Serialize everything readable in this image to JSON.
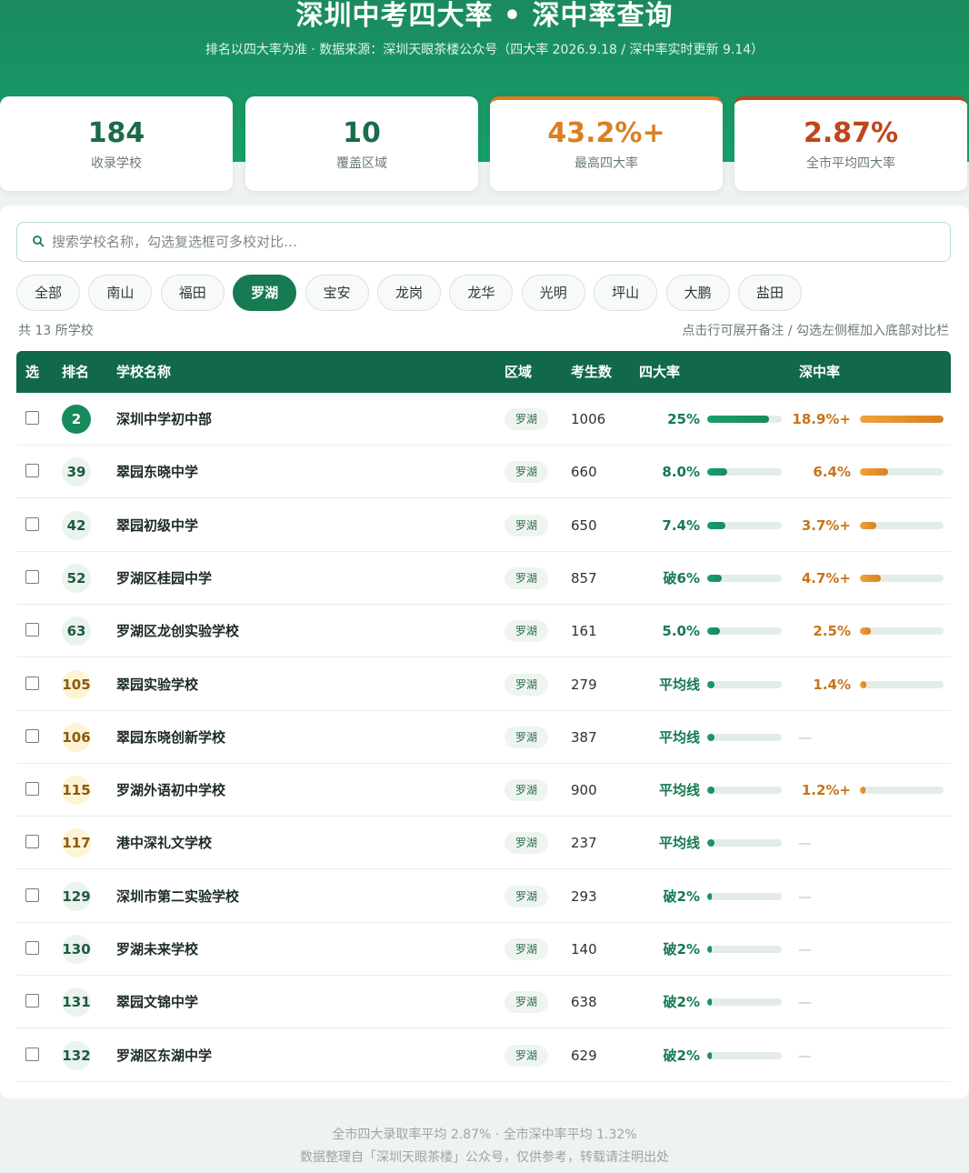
{
  "header": {
    "title": "深圳中考四大率 • 深中率查询",
    "subtitle": "排名以四大率为准 · 数据来源：深圳天眼茶楼公众号（四大率 2026.9.18 / 深中率实时更新 9.14）"
  },
  "stats": [
    {
      "value": "184",
      "label": "收录学校",
      "color": "#1a6b4a"
    },
    {
      "value": "10",
      "label": "覆盖区域",
      "color": "#1a6b4a"
    },
    {
      "value": "43.2%+",
      "label": "最高四大率",
      "color": "#d9801f"
    },
    {
      "value": "2.87%",
      "label": "全市平均四大率",
      "color": "#c0451a"
    }
  ],
  "search": {
    "placeholder": "搜索学校名称，勾选复选框可多校对比…",
    "value": ""
  },
  "filters": [
    "全部",
    "南山",
    "福田",
    "罗湖",
    "宝安",
    "龙岗",
    "龙华",
    "光明",
    "坪山",
    "大鹏",
    "盐田"
  ],
  "active_filter": "罗湖",
  "list_info": {
    "count": "共 13 所学校",
    "hint": "点击行可展开备注 / 勾选左侧框加入底部对比栏"
  },
  "table": {
    "headers": [
      "选",
      "排名",
      "学校名称",
      "区域",
      "考生数",
      "四大率",
      "深中率"
    ],
    "rows": [
      {
        "rank": "2",
        "name": "深圳中学初中部",
        "region": "罗湖",
        "students": "1006",
        "rate4": "25%",
        "rate4_value": 25,
        "sz": "18.9%+",
        "sz_value": 18.9
      },
      {
        "rank": "39",
        "name": "翠园东晓中学",
        "region": "罗湖",
        "students": "660",
        "rate4": "8.0%",
        "rate4_value": 8.0,
        "sz": "6.4%",
        "sz_value": 6.4
      },
      {
        "rank": "42",
        "name": "翠园初级中学",
        "region": "罗湖",
        "students": "650",
        "rate4": "7.4%",
        "rate4_value": 7.4,
        "sz": "3.7%+",
        "sz_value": 3.7
      },
      {
        "rank": "52",
        "name": "罗湖区桂园中学",
        "region": "罗湖",
        "students": "857",
        "rate4": "破6%",
        "rate4_value": 6.0,
        "sz": "4.7%+",
        "sz_value": 4.7
      },
      {
        "rank": "63",
        "name": "罗湖区龙创实验学校",
        "region": "罗湖",
        "students": "161",
        "rate4": "5.0%",
        "rate4_value": 5.0,
        "sz": "2.5%",
        "sz_value": 2.5
      },
      {
        "rank": "105",
        "name": "翠园实验学校",
        "region": "罗湖",
        "students": "279",
        "rate4": "平均线",
        "rate4_value": 2.87,
        "sz": "1.4%",
        "sz_value": 1.4
      },
      {
        "rank": "106",
        "name": "翠园东晓创新学校",
        "region": "罗湖",
        "students": "387",
        "rate4": "平均线",
        "rate4_value": 2.87,
        "sz": "—",
        "sz_value": null
      },
      {
        "rank": "115",
        "name": "罗湖外语初中学校",
        "region": "罗湖",
        "students": "900",
        "rate4": "平均线",
        "rate4_value": 2.87,
        "sz": "1.2%+",
        "sz_value": 1.2
      },
      {
        "rank": "117",
        "name": "港中深礼文学校",
        "region": "罗湖",
        "students": "237",
        "rate4": "平均线",
        "rate4_value": 2.87,
        "sz": "—",
        "sz_value": null
      },
      {
        "rank": "129",
        "name": "深圳市第二实验学校",
        "region": "罗湖",
        "students": "293",
        "rate4": "破2%",
        "rate4_value": 2.0,
        "sz": "—",
        "sz_value": null
      },
      {
        "rank": "130",
        "name": "罗湖未来学校",
        "region": "罗湖",
        "students": "140",
        "rate4": "破2%",
        "rate4_value": 2.0,
        "sz": "—",
        "sz_value": null
      },
      {
        "rank": "131",
        "name": "翠园文锦中学",
        "region": "罗湖",
        "students": "638",
        "rate4": "破2%",
        "rate4_value": 2.0,
        "sz": "—",
        "sz_value": null
      },
      {
        "rank": "132",
        "name": "罗湖区东湖中学",
        "region": "罗湖",
        "students": "629",
        "rate4": "破2%",
        "rate4_value": 2.0,
        "sz": "—",
        "sz_value": null
      }
    ]
  },
  "footer": {
    "line1": "全市四大录取率平均 2.87% · 全市深中率平均 1.32%",
    "line2": "数据整理自「深圳天眼茶楼」公众号，仅供参考，转载请注明出处"
  },
  "scale": {
    "rate4_max": 30,
    "sz_max": 19
  }
}
